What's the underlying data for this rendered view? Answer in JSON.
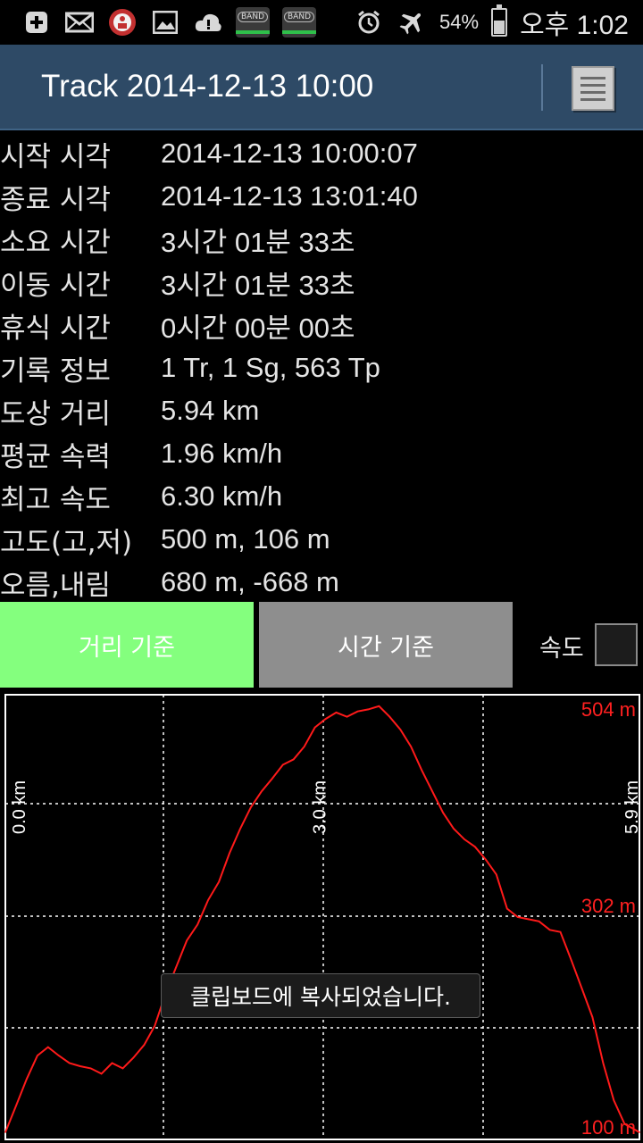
{
  "status_bar": {
    "left_icons": [
      "plus-icon",
      "mail-icon",
      "app-badge-icon",
      "gallery-icon",
      "cloud-warning-icon",
      "band-icon",
      "band-icon"
    ],
    "band_label": "BAND",
    "battery_percent": "54%",
    "time": "오후 1:02"
  },
  "header": {
    "title": "Track 2014-12-13 10:00",
    "menu_icon": "list-menu-icon",
    "background": "#2e4a66"
  },
  "info": [
    {
      "label": "시작 시각",
      "value": "2014-12-13 10:00:07"
    },
    {
      "label": "종료 시각",
      "value": "2014-12-13 13:01:40"
    },
    {
      "label": "소요 시간",
      "value": "3시간 01분 33초"
    },
    {
      "label": "이동 시간",
      "value": "3시간 01분 33초"
    },
    {
      "label": "휴식 시간",
      "value": "0시간 00분 00초"
    },
    {
      "label": "기록 정보",
      "value": "1 Tr, 1 Sg, 563 Tp"
    },
    {
      "label": "도상 거리",
      "value": "5.94 km"
    },
    {
      "label": "평균 속력",
      "value": "1.96 km/h"
    },
    {
      "label": "최고 속도",
      "value": "6.30 km/h"
    },
    {
      "label": "고도(고,저)",
      "value": "500 m, 106 m"
    },
    {
      "label": "오름,내림",
      "value": "680 m, -668 m"
    }
  ],
  "tabs": {
    "distance_label": "거리 기준",
    "time_label": "시간 기준",
    "speed_label": "속도",
    "active_color": "#84ff7e",
    "inactive_color": "#8e8e8e"
  },
  "chart_data": {
    "type": "line",
    "title": "",
    "xlabel": "",
    "ylabel": "",
    "x_ticks": [
      "0.0 km",
      "3.0 km",
      "5.9 km"
    ],
    "y_ticks": [
      "504 m",
      "302 m",
      "100 m"
    ],
    "ylim": [
      100,
      504
    ],
    "xlim": [
      0,
      5.94
    ],
    "grid": true,
    "line_color": "#ff1a1a",
    "series": [
      {
        "x": [
          0.0,
          0.1,
          0.2,
          0.3,
          0.4,
          0.5,
          0.6,
          0.7,
          0.8,
          0.9,
          1.0,
          1.1,
          1.2,
          1.3,
          1.4,
          1.5,
          1.6,
          1.7,
          1.8,
          1.9,
          2.0,
          2.1,
          2.2,
          2.3,
          2.4,
          2.5,
          2.6,
          2.7,
          2.8,
          2.9,
          3.0,
          3.1,
          3.2,
          3.3,
          3.4,
          3.5,
          3.6,
          3.7,
          3.8,
          3.9,
          4.0,
          4.1,
          4.2,
          4.3,
          4.4,
          4.5,
          4.6,
          4.7,
          4.8,
          4.9,
          5.0,
          5.1,
          5.2,
          5.3,
          5.4,
          5.5,
          5.6,
          5.7,
          5.8,
          5.94
        ],
        "values": [
          100,
          125,
          150,
          172,
          180,
          172,
          165,
          162,
          160,
          155,
          165,
          160,
          170,
          182,
          200,
          230,
          255,
          280,
          295,
          318,
          335,
          362,
          385,
          405,
          420,
          432,
          445,
          450,
          462,
          480,
          488,
          494,
          490,
          495,
          497,
          500,
          490,
          478,
          462,
          440,
          420,
          400,
          385,
          375,
          368,
          356,
          342,
          310,
          302,
          300,
          298,
          290,
          288,
          262,
          235,
          208,
          165,
          130,
          108,
          100
        ]
      }
    ]
  },
  "toast": {
    "message": "클립보드에 복사되었습니다."
  }
}
